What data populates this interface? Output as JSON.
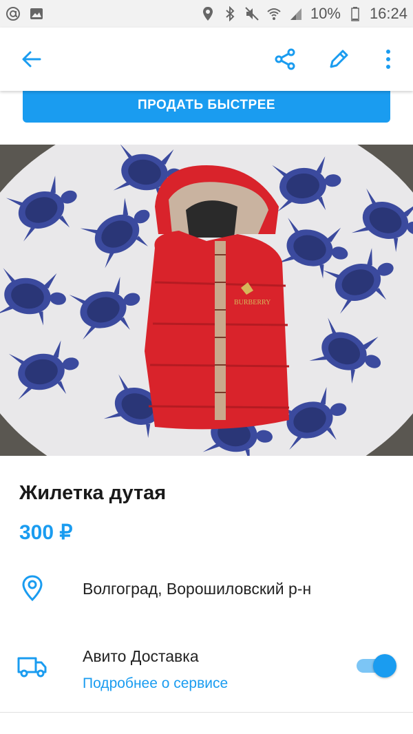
{
  "status_bar": {
    "battery": "10%",
    "time": "16:24",
    "icons_left": [
      "at-icon",
      "image-icon"
    ],
    "icons_right": [
      "location-icon",
      "bluetooth-icon",
      "mute-icon",
      "wifi-icon",
      "signal-icon",
      "battery-icon"
    ]
  },
  "app_bar": {
    "icons": [
      "back-arrow-icon",
      "share-icon",
      "edit-icon",
      "more-vert-icon"
    ],
    "accent": "#1a9cf0"
  },
  "sell_button": {
    "label": "ПРОДАТЬ БЫСТРЕЕ"
  },
  "listing": {
    "title": "Жилетка дутая",
    "price": "300 ₽",
    "location": "Волгоград, Ворошиловский р-н"
  },
  "delivery": {
    "title": "Авито Доставка",
    "link": "Подробнее о сервисе",
    "enabled": true
  },
  "colors": {
    "accent": "#1a9cf0",
    "text": "#1a1a1a",
    "vest": "#d9232b"
  }
}
